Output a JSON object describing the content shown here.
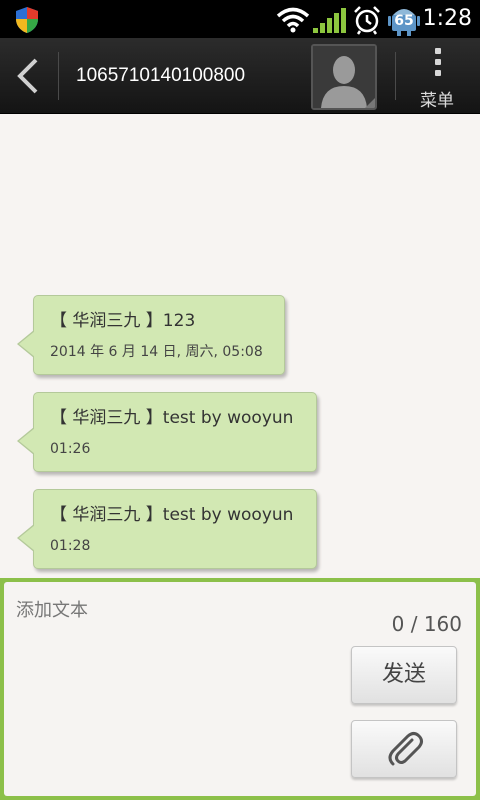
{
  "status_bar": {
    "time": "1:28",
    "battery_level": "65",
    "icons": [
      "shield-icon",
      "wifi-icon",
      "signal-icon",
      "alarm-icon",
      "android-battery-icon"
    ]
  },
  "header": {
    "contact_number": "1065710140100800",
    "menu_label": "菜单",
    "icons": [
      "back-arrow-icon",
      "contact-avatar",
      "menu-dots-icon"
    ]
  },
  "messages": [
    {
      "text": "【 华润三九 】123",
      "time": "2014 年 6 月 14 日, 周六, 05:08"
    },
    {
      "text": "【 华润三九 】test by wooyun",
      "time": "01:26"
    },
    {
      "text": "【 华润三九 】test by wooyun",
      "time": "01:28"
    }
  ],
  "compose": {
    "placeholder": "添加文本",
    "value": "",
    "char_count": "0 / 160",
    "send_label": "发送",
    "attach_icon": "paperclip-icon"
  },
  "colors": {
    "bubble": "#d2e8b3",
    "compose_border": "#8cc04a",
    "background": "#f7f4f2",
    "titlebar": "#1e1e1e"
  }
}
